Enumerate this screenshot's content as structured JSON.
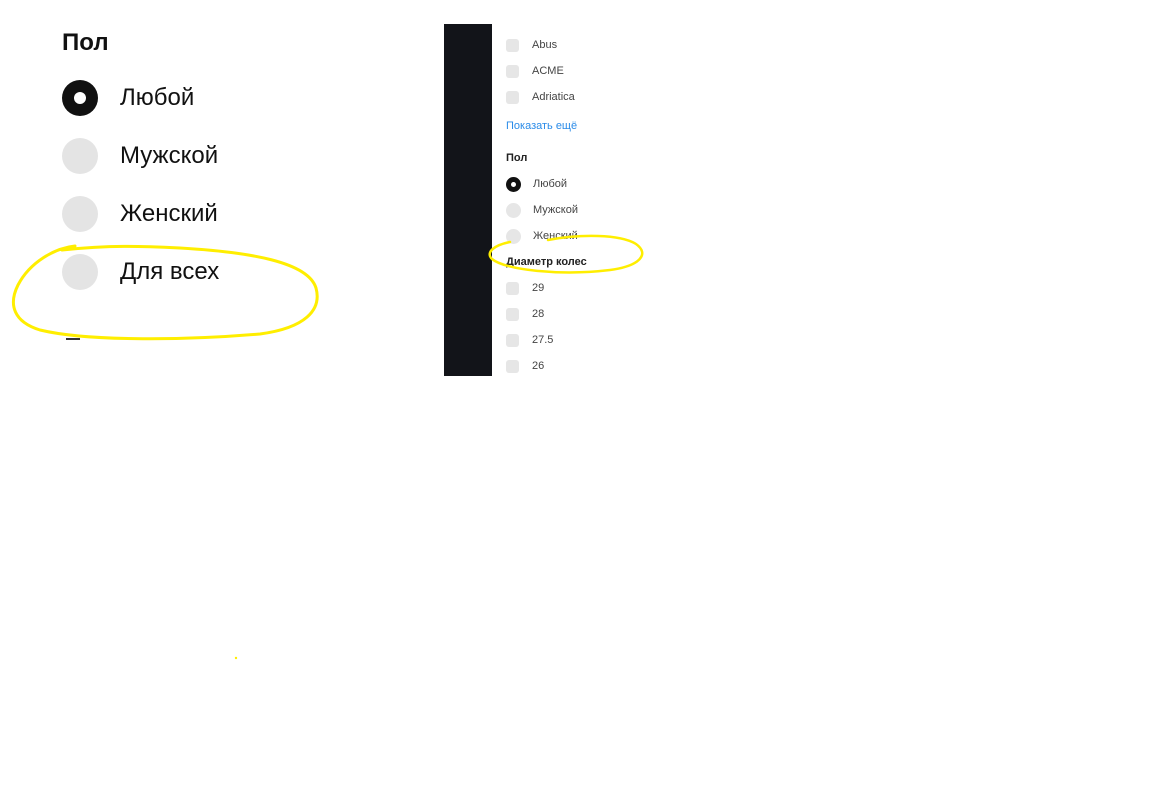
{
  "big_filter": {
    "title": "Пол",
    "options": [
      {
        "label": "Любой",
        "checked": true
      },
      {
        "label": "Мужской",
        "checked": false
      },
      {
        "label": "Женский",
        "checked": false
      },
      {
        "label": "Для всех",
        "checked": false
      }
    ]
  },
  "thumbnail": {
    "brands": [
      "Abus",
      "ACME",
      "Adriatica"
    ],
    "show_more": "Показать ещё",
    "gender_title": "Пол",
    "gender_options": [
      {
        "label": "Любой",
        "checked": true
      },
      {
        "label": "Мужской",
        "checked": false
      },
      {
        "label": "Женский",
        "checked": false
      }
    ],
    "wheel_title": "Диаметр колес",
    "wheel_sizes": [
      "29",
      "28",
      "27.5",
      "26"
    ]
  },
  "colors": {
    "annotation": "#ffee00",
    "link": "#2a8be8",
    "radio_checked": "#111111",
    "radio_unchecked": "#e4e4e4",
    "sidebar_dark": "#121419"
  }
}
